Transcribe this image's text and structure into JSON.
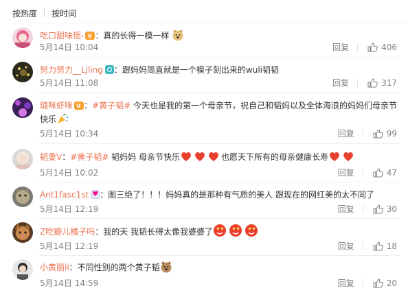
{
  "tabs": {
    "hot": "按热度",
    "time": "按时间"
  },
  "actions": {
    "reply_label": "回复"
  },
  "comments": [
    {
      "user": "吃口甜味瑶-",
      "body": "：真的长得一模一样",
      "time": "5月14日 10:04",
      "likes": "406"
    },
    {
      "user": "努力努力__Ljling",
      "body": "：跟妈妈简直就是一个模子刻出来的wuli韬韬",
      "time": "5月14日 11:08",
      "likes": "317"
    },
    {
      "user": "璐咪虾咪",
      "topic": "#黄子韬#",
      "body_a": " 今天也是我的第一个母亲节，祝自己和韬妈以及全体海浪的妈妈们母亲节",
      "body_b": "快乐",
      "time": "5月14日 10:34",
      "likes": "99"
    },
    {
      "user": "韬妻V",
      "topic": "#黄子韬#",
      "body_a": " 韬妈妈 母亲节快乐",
      "body_b": "也愿天下所有的母亲健康长寿",
      "time": "5月14日 10:02",
      "likes": "47"
    },
    {
      "user": "Ant1fasc1st",
      "body": "：图三绝了！！！妈妈真的是那种有气质的美人   跟现在的网红美的太不同了",
      "time": "5月14日 12:19",
      "likes": "30"
    },
    {
      "user": "Z吃瓣儿橘子吗",
      "body": "：我的天 我韬长得太像我婆婆了",
      "time": "5月14日 12:19",
      "likes": "18"
    },
    {
      "user": "小黄丽ii",
      "body": "：不同性别的两个黄子韬",
      "time": "5月14日 14:59",
      "likes": "20"
    }
  ]
}
